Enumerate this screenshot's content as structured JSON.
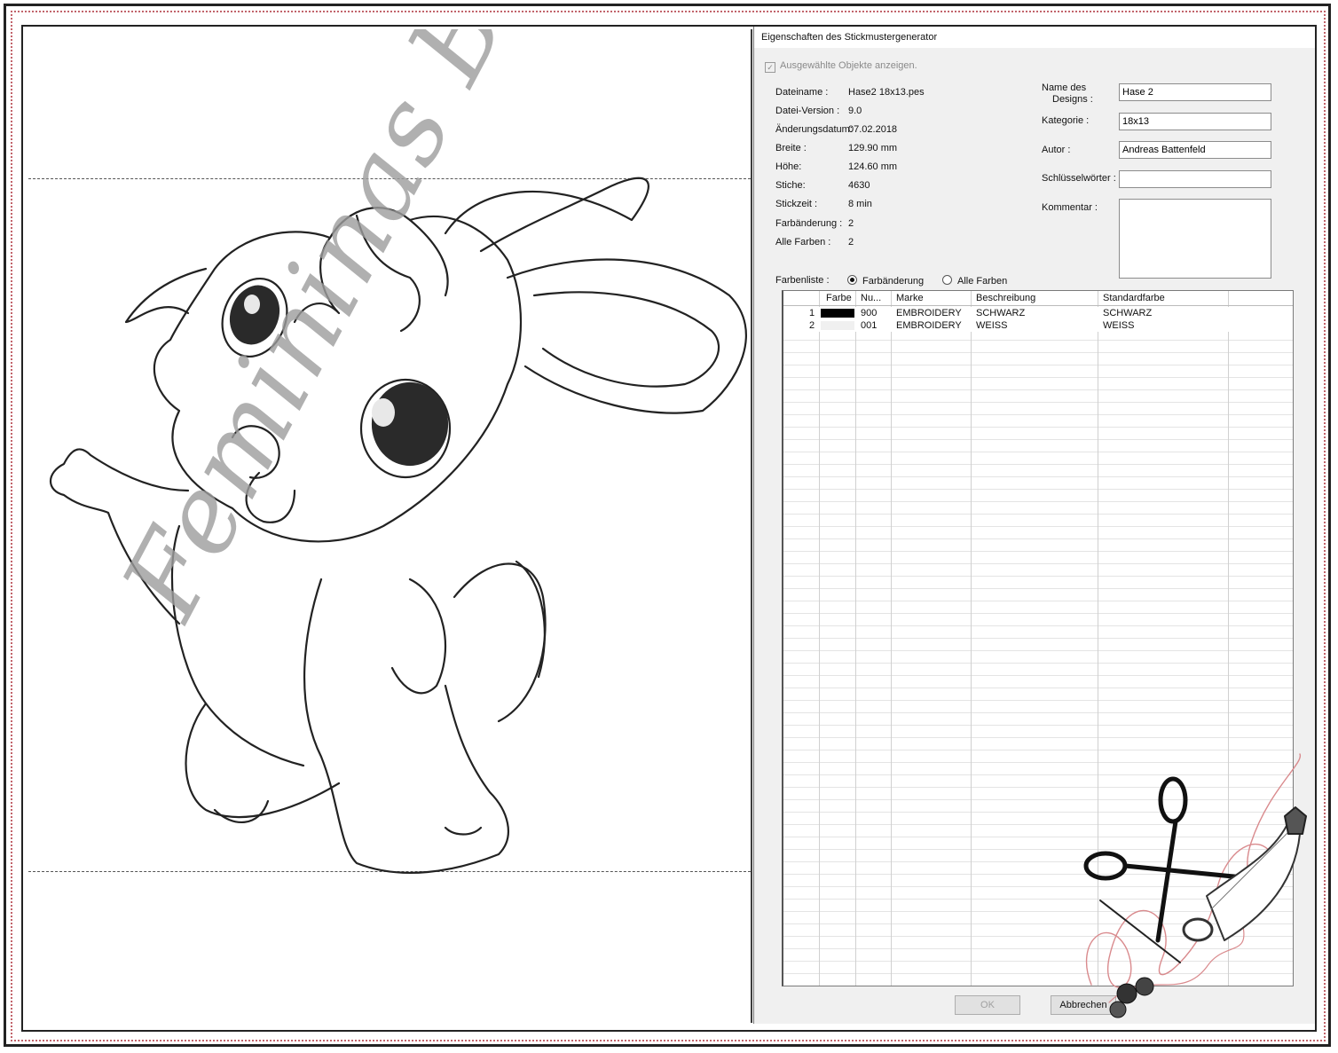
{
  "dialog": {
    "title": "Eigenschaften des Stickmustergenerator",
    "show_selected_label": "Ausgewählte Objekte anzeigen.",
    "info": [
      {
        "label": "Dateiname :",
        "value": "Hase2 18x13.pes"
      },
      {
        "label": "Datei-Version :",
        "value": "9.0"
      },
      {
        "label": "Änderungsdatum:",
        "value": "07.02.2018"
      },
      {
        "label": "Breite :",
        "value": "129.90 mm"
      },
      {
        "label": "Höhe:",
        "value": "124.60 mm"
      },
      {
        "label": "Stiche:",
        "value": "4630"
      },
      {
        "label": "Stickzeit :",
        "value": "8 min"
      },
      {
        "label": "Farbänderung :",
        "value": "2"
      },
      {
        "label": "Alle Farben :",
        "value": "2"
      }
    ],
    "fields": {
      "design_name_label_1": "Name des",
      "design_name_label_2": "Designs :",
      "design_name_value": "Hase 2",
      "category_label": "Kategorie :",
      "category_value": "18x13",
      "author_label": "Autor :",
      "author_value": "Andreas Battenfeld",
      "keywords_label": "Schlüsselwörter :",
      "keywords_value": "",
      "comment_label": "Kommentar :"
    },
    "color_list": {
      "label": "Farbenliste :",
      "option_change": "Farbänderung",
      "option_all": "Alle Farben",
      "selected": "Farbänderung"
    },
    "table": {
      "headers": [
        "Farbe",
        "Nu...",
        "Marke",
        "Beschreibung",
        "Standardfarbe"
      ],
      "rows": [
        {
          "index": "1",
          "color": "#000000",
          "number": "900",
          "brand": "EMBROIDERY",
          "description": "SCHWARZ",
          "standard": "SCHWARZ"
        },
        {
          "index": "2",
          "color": "#f0f0f0",
          "number": "001",
          "brand": "EMBROIDERY",
          "description": "WEISS",
          "standard": "WEISS"
        }
      ]
    },
    "buttons": {
      "ok": "OK",
      "cancel": "Abbrechen"
    }
  },
  "watermark": "Femininas Bastelei",
  "colors": {
    "frame_dots": "#c2646b",
    "dialog_bg": "#f0f0f0",
    "watermark": "#9d9d9d"
  }
}
